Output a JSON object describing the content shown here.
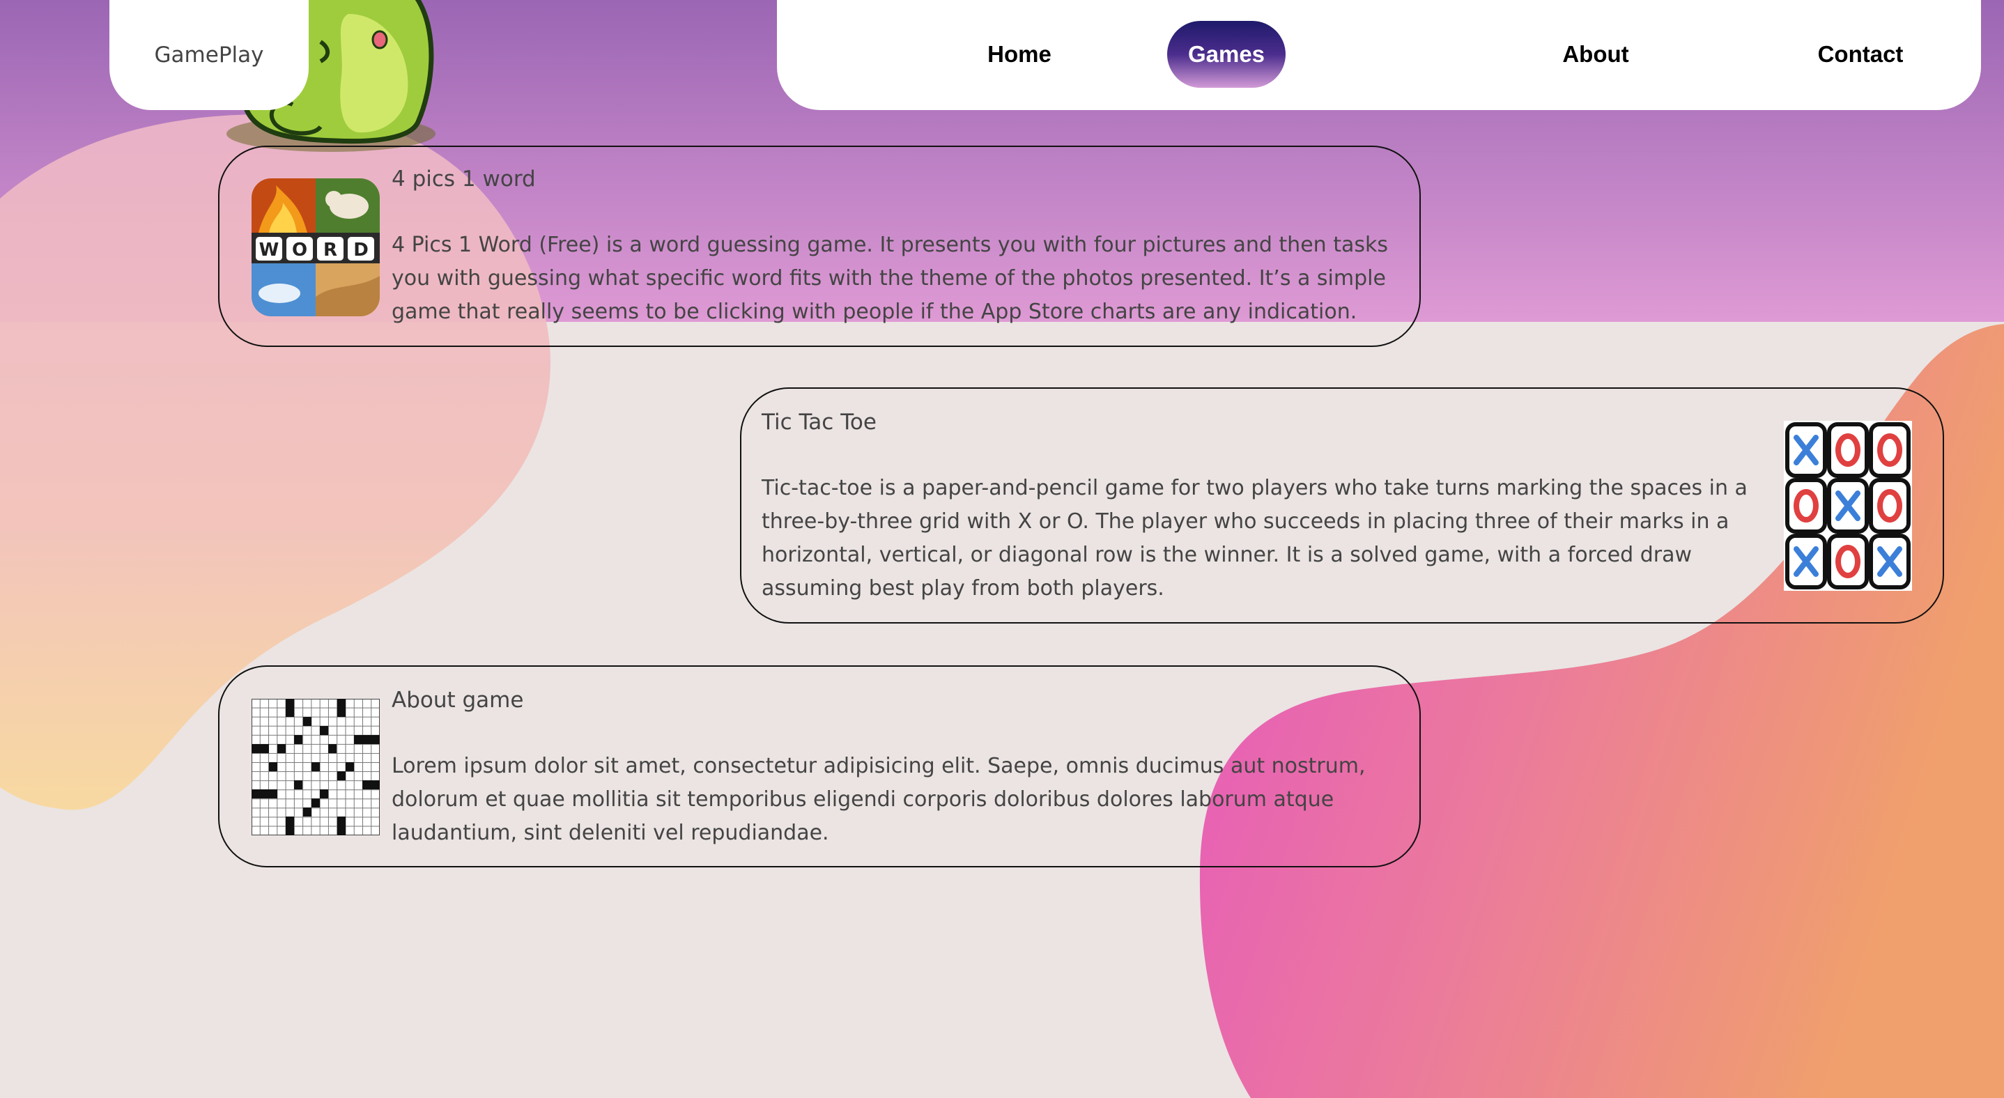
{
  "logo": {
    "text": "GamePlay"
  },
  "nav": {
    "items": [
      {
        "label": "Home",
        "active": false
      },
      {
        "label": "Games",
        "active": true
      },
      {
        "label": "About",
        "active": false
      },
      {
        "label": "Contact",
        "active": false
      }
    ]
  },
  "games": [
    {
      "title": "4 pics 1 word",
      "description": "4 Pics 1 Word (Free) is a word guessing game. It presents you with four pictures and then tasks you with guessing what specific word fits with the theme of the photos presented. It’s a simple game that really seems to be clicking with people if the App Store charts are any indication.",
      "thumb_text": "WORD"
    },
    {
      "title": "Tic Tac Toe",
      "description": "Tic-tac-toe is a paper-and-pencil game for two players who take turns marking the spaces in a three-by-three grid with X or O. The player who succeeds in placing three of their marks in a horizontal, vertical, or diagonal row is the winner. It is a solved game, with a forced draw assuming best play from both players."
    },
    {
      "title": "About game",
      "description": "Lorem ipsum dolor sit amet, consectetur adipisicing elit. Saepe, omnis ducimus aut nostrum, dolorum et quae mollitia sit temporibus eligendi corporis doloribus dolores laborum atque laudantium, sint deleniti vel repudiandae."
    }
  ],
  "colors": {
    "nav_active_top": "#1e1a6a",
    "nav_active_bottom": "#d29ad6",
    "background": "#ebe4e3",
    "header_gradient_top": "#9b66b4",
    "header_gradient_bottom": "#de9ad4",
    "blob_left_top": "#edb6c8",
    "blob_left_bottom": "#f9d89b",
    "blob_right_pink": "#e656c0",
    "blob_right_orange": "#f0a06c"
  }
}
